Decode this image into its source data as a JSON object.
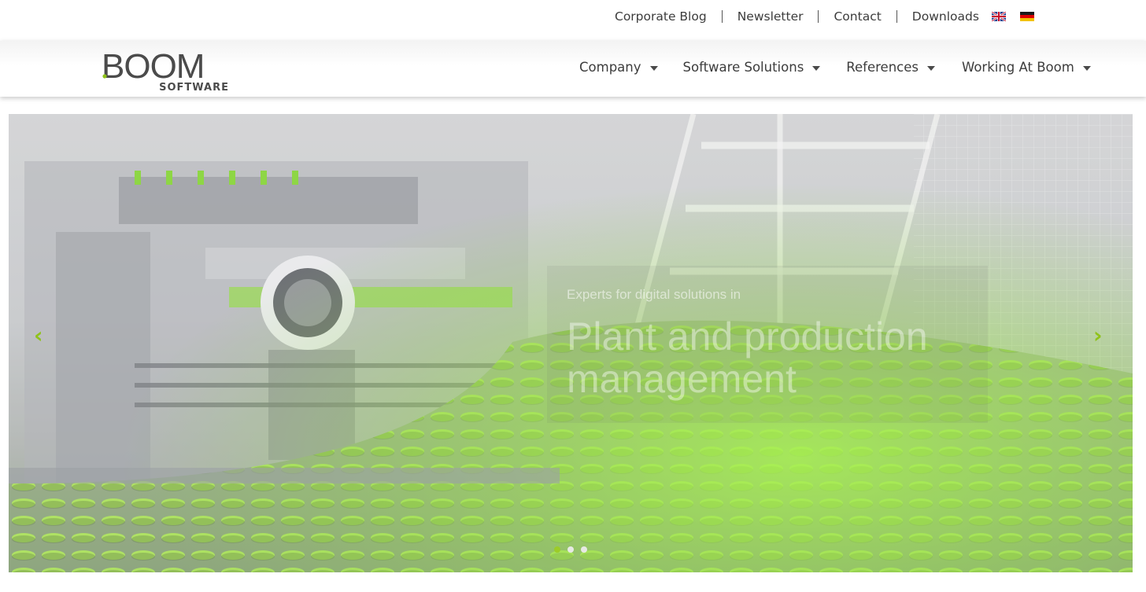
{
  "top_links": [
    {
      "label": "Corporate Blog"
    },
    {
      "label": "Newsletter"
    },
    {
      "label": "Contact"
    },
    {
      "label": "Downloads"
    }
  ],
  "languages": [
    {
      "name": "English",
      "icon": "uk-flag-icon"
    },
    {
      "name": "Deutsch",
      "icon": "german-flag-icon"
    }
  ],
  "logo": {
    "word": "BOOM",
    "sub": "SOFTWARE"
  },
  "nav": [
    {
      "label": "Company"
    },
    {
      "label": "Software Solutions"
    },
    {
      "label": "References"
    },
    {
      "label": "Working At Boom"
    }
  ],
  "hero": {
    "pre_title": "Experts for digital solutions in",
    "title": "Plant and production management",
    "prev_icon": "chevron-left-icon",
    "next_icon": "chevron-right-icon",
    "slides_total": 3,
    "active_slide": 1
  },
  "colors": {
    "accent_green": "#8fc21a",
    "text_dark": "#3c3c3c"
  }
}
